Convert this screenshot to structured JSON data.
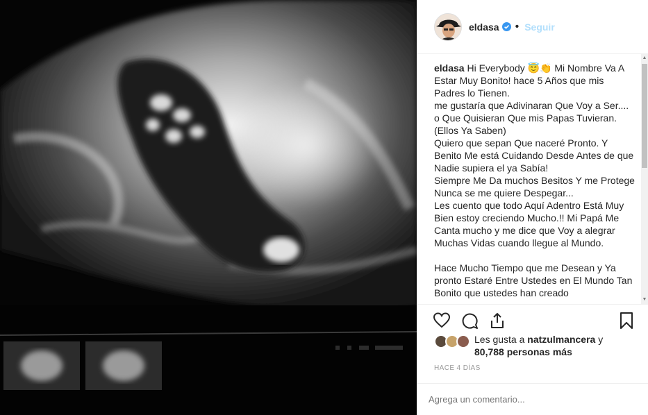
{
  "post": {
    "username": "eldasa",
    "follow_label": "Seguir",
    "caption_user": "eldasa",
    "caption_text": " Hi Everybody 😇👏 Mi Nombre Va A Estar Muy Bonito! hace 5 Años que mis Padres lo Tienen.\nme gustaría que Adivinaran Que Voy a Ser.... o Que Quisieran Que mis Papas Tuvieran.(Ellos Ya Saben)\nQuiero que sepan Que naceré Pronto. Y Benito Me está Cuidando Desde Antes de que Nadie supiera el ya Sabía!\nSiempre Me Da muchos Besitos Y me Protege Nunca se me quiere Despegar...\nLes cuento que todo Aquí Adentro Está Muy Bien estoy creciendo Mucho.!! Mi Papá Me Canta mucho y me dice que Voy a alegrar Muchas Vidas cuando llegue al Mundo.\n\nHace Mucho Tiempo que me Desean y Ya pronto Estaré Entre Ustedes en El Mundo Tan Bonito que ustedes han creado",
    "likes_prefix": "Les gusta a ",
    "likes_user": "natzulmancera",
    "likes_mid": " y ",
    "likes_count": "80,788 personas más",
    "timestamp": "HACE 4 DÍAS",
    "comment_placeholder": "Agrega un comentario..."
  },
  "icons": {
    "like": "heart-icon",
    "comment": "comment-icon",
    "share": "share-icon",
    "save": "bookmark-icon",
    "verified": "verified-badge-icon"
  },
  "colors": {
    "accent": "#3897f0",
    "follow_disabled": "#b2dffc",
    "text": "#262626",
    "muted": "#999999"
  }
}
